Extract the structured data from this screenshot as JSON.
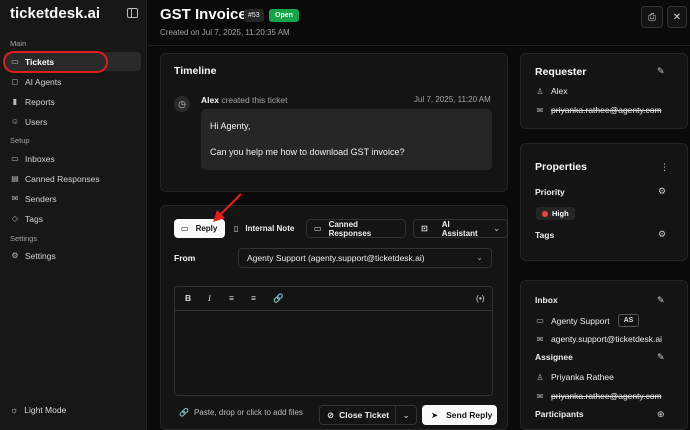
{
  "sidebar": {
    "brand": "ticketdesk.ai",
    "sections": {
      "main": "Main",
      "setup": "Setup",
      "settings": "Settings"
    },
    "items": [
      {
        "label": "Tickets",
        "icon": "ticket-icon"
      },
      {
        "label": "AI Agents",
        "icon": "bot-icon"
      },
      {
        "label": "Reports",
        "icon": "chart-icon"
      },
      {
        "label": "Users",
        "icon": "users-icon"
      },
      {
        "label": "Inboxes",
        "icon": "inbox-icon"
      },
      {
        "label": "Canned Responses",
        "icon": "template-icon"
      },
      {
        "label": "Senders",
        "icon": "mail-icon"
      },
      {
        "label": "Tags",
        "icon": "tag-icon"
      },
      {
        "label": "Settings",
        "icon": "gear-icon"
      }
    ],
    "footer": "Light Mode"
  },
  "header": {
    "title": "GST Invoice",
    "number": "#53",
    "status": "Open",
    "created": "Created on Jul 7, 2025, 11:20:35 AM"
  },
  "timeline": {
    "title": "Timeline",
    "author": "Alex",
    "action": "created this ticket",
    "time": "Jul 7, 2025, 11:20 AM",
    "greeting": "Hi Agenty,",
    "body": "Can you help me how to download GST invoice?"
  },
  "composer": {
    "tabs": [
      "Reply",
      "Internal Note",
      "Canned Responses",
      "AI Assistant"
    ],
    "from_label": "From",
    "from_value": "Agenty Support (agenty.support@ticketdesk.ai)",
    "toolbar": [
      "B",
      "I",
      "≡",
      "≡",
      "🔗",
      "(•)"
    ],
    "attach_hint": "Paste, drop or click to add files",
    "close_label": "Close Ticket",
    "send_label": "Send Reply"
  },
  "requester": {
    "title": "Requester",
    "name": "Alex",
    "email": "priyanka.rathee@agenty.com"
  },
  "properties": {
    "title": "Properties",
    "priority_label": "Priority",
    "priority_value": "High",
    "tags_label": "Tags"
  },
  "assignment": {
    "inbox_label": "Inbox",
    "inbox_name": "Agenty Support",
    "inbox_badge": "AS",
    "inbox_email": "agenty.support@ticketdesk.ai",
    "assignee_label": "Assignee",
    "assignee_name": "Priyanka Rathee",
    "assignee_email": "priyanka.rathee@agenty.com",
    "participants_label": "Participants"
  },
  "colors": {
    "status_open": "#16a34a",
    "priority_high": "#ef4444",
    "annotation": "#e11d1d"
  }
}
